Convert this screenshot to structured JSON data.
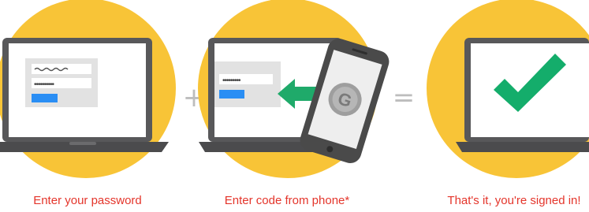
{
  "steps": [
    {
      "caption": "Enter your password",
      "illustration": "laptop-login-form",
      "password_mask": "••••••••••"
    },
    {
      "caption": "Enter code from phone*",
      "illustration": "phone-authenticator-code",
      "code_mask": "•••••••••",
      "phone_app_letter": "G"
    },
    {
      "caption": "That's it, you're signed in!",
      "illustration": "laptop-checkmark"
    }
  ],
  "operators": {
    "plus": "+",
    "equals": "="
  },
  "colors": {
    "circle_yellow": "#f8c437",
    "caption_red": "#e4352b",
    "laptop_gray": "#58585a",
    "screen_white": "#ffffff",
    "form_gray": "#e2e2e2",
    "button_blue": "#2a8ef4",
    "arrow_green": "#1faa6a",
    "check_green": "#14ad6b",
    "operator_gray": "#bdbdbd"
  }
}
